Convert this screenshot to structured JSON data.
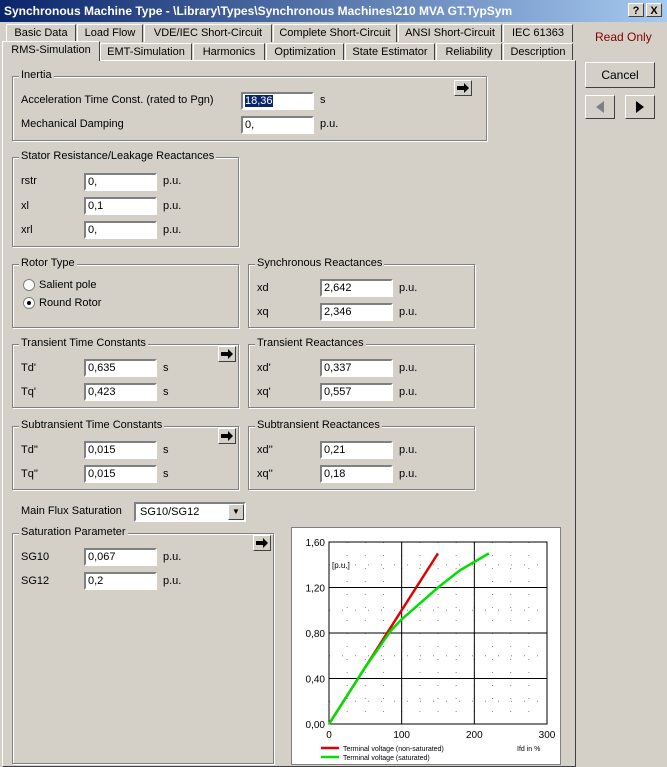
{
  "window": {
    "title": "Synchronous Machine Type - \\Library\\Types\\Synchronous Machines\\210 MVA GT.TypSym",
    "help_label": "?",
    "close_label": "X"
  },
  "tabs_row1": [
    "Basic Data",
    "Load Flow",
    "VDE/IEC Short-Circuit",
    "Complete Short-Circuit",
    "ANSI Short-Circuit",
    "IEC 61363"
  ],
  "tabs_row2": [
    "RMS-Simulation",
    "EMT-Simulation",
    "Harmonics",
    "Optimization",
    "State Estimator",
    "Reliability",
    "Description"
  ],
  "read_only": "Read Only",
  "cancel_label": "Cancel",
  "inertia": {
    "title": "Inertia",
    "accel_label": "Acceleration Time Const. (rated to Pgn)",
    "accel_value": "18,36",
    "accel_unit": "s",
    "damping_label": "Mechanical Damping",
    "damping_value": "0,",
    "damping_unit": "p.u."
  },
  "stator": {
    "title": "Stator Resistance/Leakage Reactances",
    "rstr_label": "rstr",
    "rstr_value": "0,",
    "xl_label": "xl",
    "xl_value": "0,1",
    "xrl_label": "xrl",
    "xrl_value": "0,",
    "unit": "p.u."
  },
  "rotor": {
    "title": "Rotor Type",
    "salient": "Salient pole",
    "round": "Round Rotor",
    "selected": "round"
  },
  "sync": {
    "title": "Synchronous Reactances",
    "xd_label": "xd",
    "xd_value": "2,642",
    "xq_label": "xq",
    "xq_value": "2,346",
    "unit": "p.u."
  },
  "transient_time": {
    "title": "Transient Time Constants",
    "td_label": "Td'",
    "td_value": "0,635",
    "tq_label": "Tq'",
    "tq_value": "0,423",
    "unit": "s"
  },
  "transient_react": {
    "title": "Transient Reactances",
    "xd_label": "xd'",
    "xd_value": "0,337",
    "xq_label": "xq'",
    "xq_value": "0,557",
    "unit": "p.u."
  },
  "subtransient_time": {
    "title": "Subtransient Time Constants",
    "td_label": "Td''",
    "td_value": "0,015",
    "tq_label": "Tq''",
    "tq_value": "0,015",
    "unit": "s"
  },
  "subtransient_react": {
    "title": "Subtransient Reactances",
    "xd_label": "xd''",
    "xd_value": "0,21",
    "xq_label": "xq''",
    "xq_value": "0,18",
    "unit": "p.u."
  },
  "saturation": {
    "main_flux_label": "Main Flux Saturation",
    "main_flux_value": "SG10/SG12",
    "param_title": "Saturation Parameter",
    "sg10_label": "SG10",
    "sg10_value": "0,067",
    "sg12_label": "SG12",
    "sg12_value": "0,2",
    "unit": "p.u."
  },
  "chart_data": {
    "type": "line",
    "ylabel": "[p.u.]",
    "xlabel": "Ifd in %",
    "xlim": [
      0,
      300
    ],
    "ylim": [
      0,
      1.6
    ],
    "x_ticks": [
      "0",
      "100",
      "200",
      "300"
    ],
    "y_ticks": [
      "0,00",
      "0,40",
      "0,80",
      "1,20",
      "1,60"
    ],
    "grid": true,
    "legend_position": "bottom",
    "series": [
      {
        "name": "Terminal voltage (non-saturated)",
        "color": "#e00000",
        "x": [
          0,
          50,
          100,
          150
        ],
        "y": [
          0,
          0.5,
          1.0,
          1.5
        ]
      },
      {
        "name": "Terminal voltage (saturated)",
        "color": "#00e000",
        "x": [
          0,
          50,
          85,
          100,
          125,
          150,
          180,
          220
        ],
        "y": [
          0,
          0.5,
          0.82,
          0.92,
          1.06,
          1.2,
          1.35,
          1.5
        ]
      }
    ]
  }
}
